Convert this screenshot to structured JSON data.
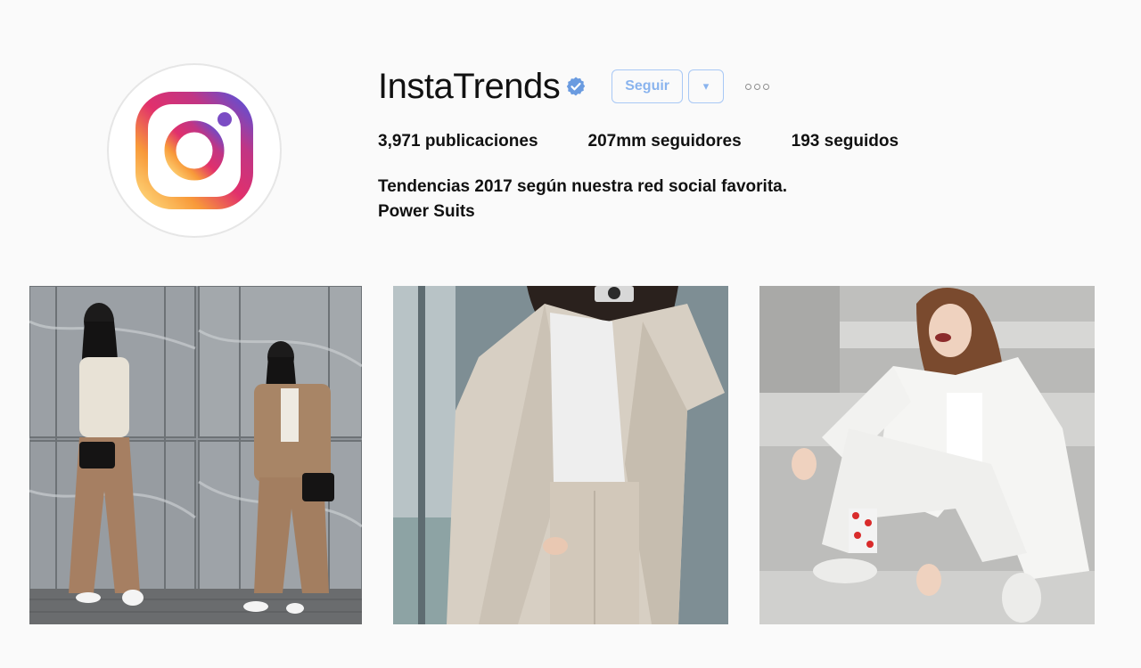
{
  "profile": {
    "username": "InstaTrends",
    "verified": true,
    "avatar_icon": "instagram-logo-icon"
  },
  "actions": {
    "follow_label": "Seguir",
    "dropdown_label": "▾",
    "more_icon": "more-options-icon"
  },
  "stats": {
    "posts": "3,971 publicaciones",
    "followers": "207mm seguidores",
    "following": "193 seguidos"
  },
  "bio": {
    "line1": "Tendencias 2017 según nuestra red social favorita.",
    "line2": "Power Suits"
  },
  "posts": [
    {
      "id": "post-1",
      "icon": "photo"
    },
    {
      "id": "post-2",
      "icon": "photo"
    },
    {
      "id": "post-3",
      "icon": "photo"
    }
  ],
  "colors": {
    "accent_blue": "#8ab4ee",
    "verified_blue": "#6a9be0",
    "background": "#fafafa"
  }
}
